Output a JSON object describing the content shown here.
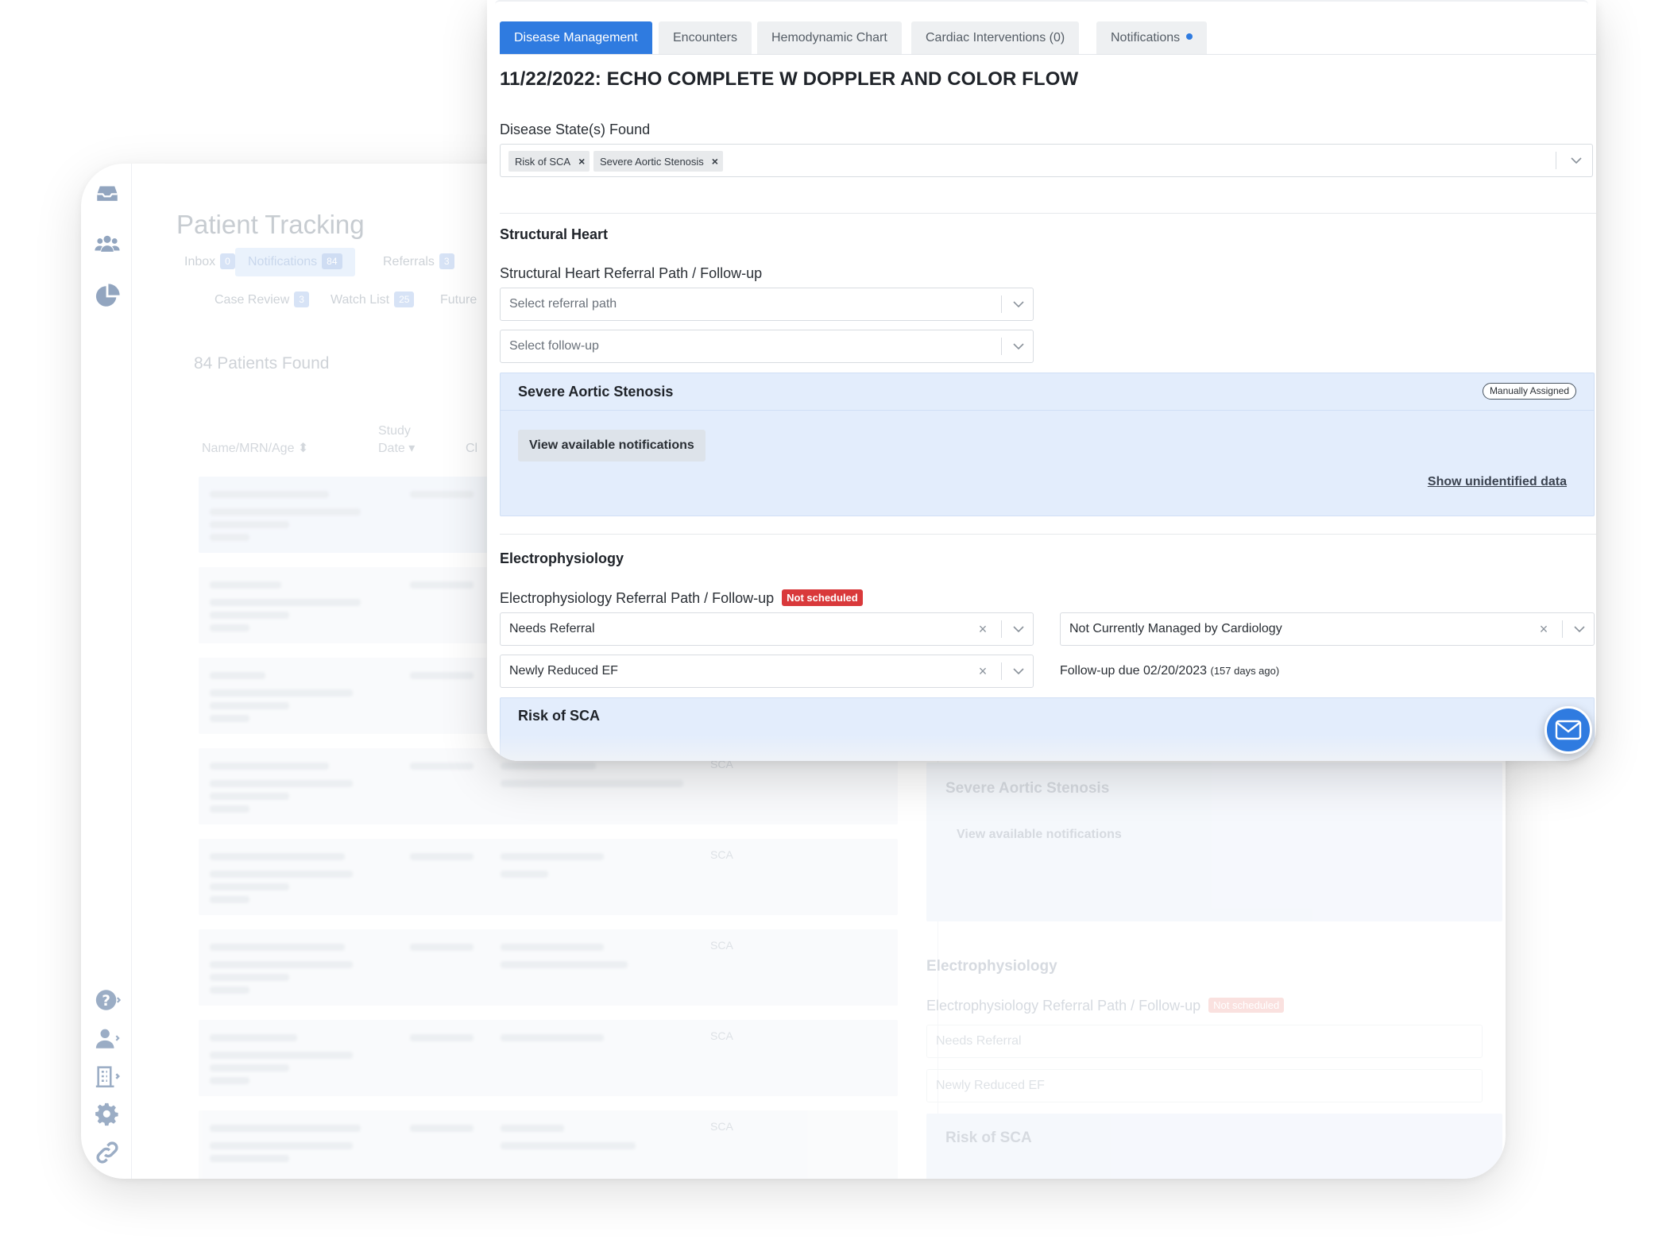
{
  "background": {
    "page_title": "Patient Tracking",
    "tabs_row1": [
      {
        "label": "Inbox",
        "count": "0"
      },
      {
        "label": "Notifications",
        "count": "84"
      },
      {
        "label": "Referrals",
        "count": "3"
      }
    ],
    "tabs_row2": [
      {
        "label": "Case Review",
        "count": "3"
      },
      {
        "label": "Watch List",
        "count": "25"
      },
      {
        "label": "Future"
      }
    ],
    "patients_found": "84 Patients Found",
    "columns": {
      "name": "Name/MRN/Age ⬍",
      "study_line1": "Study",
      "study_line2": "Date ▾",
      "clinical": "Cl"
    },
    "row_tags": [
      "SCA",
      "SCA",
      "SCA",
      "SCA",
      "SCA"
    ],
    "right_panel": {
      "severe_title": "Severe Aortic Stenosis",
      "view_notifications": "View available notifications",
      "ep_heading": "Electrophysiology",
      "ep_label": "Electrophysiology Referral Path / Follow-up",
      "not_scheduled": "Not scheduled",
      "select1": "Needs Referral",
      "select2": "Newly Reduced EF",
      "risk_title": "Risk of SCA"
    },
    "rail_icons": [
      "inbox-icon",
      "patients-icon",
      "pie-chart-icon",
      "help-icon",
      "user-icon",
      "building-icon",
      "settings-icon",
      "link-icon"
    ]
  },
  "foreground": {
    "tabs": [
      {
        "label": "Disease Management",
        "active": true
      },
      {
        "label": "Encounters"
      },
      {
        "label": "Hemodynamic Chart"
      },
      {
        "label": "Cardiac Interventions (0)"
      },
      {
        "label": "Notifications",
        "has_dot": true
      }
    ],
    "study_title": "11/22/2022: ECHO COMPLETE W DOPPLER AND COLOR FLOW",
    "disease_states_label": "Disease State(s) Found",
    "disease_chips": [
      "Risk of SCA",
      "Severe Aortic Stenosis"
    ],
    "structural": {
      "heading": "Structural Heart",
      "path_label": "Structural Heart Referral Path / Follow-up",
      "referral_placeholder": "Select referral path",
      "followup_placeholder": "Select follow-up",
      "panel_title": "Severe Aortic Stenosis",
      "assigned_pill": "Manually Assigned",
      "view_button": "View available notifications",
      "show_link": "Show unidentified data"
    },
    "ep": {
      "heading": "Electrophysiology",
      "path_label": "Electrophysiology Referral Path / Follow-up",
      "status_badge": "Not scheduled",
      "referral_value": "Needs Referral",
      "reason_value": "Newly Reduced EF",
      "managed_value": "Not Currently Managed by Cardiology",
      "followup_text": "Follow-up due 02/20/2023",
      "followup_ago": "(157 days ago)",
      "risk_panel_title": "Risk of SCA"
    },
    "fab_icon": "mail-icon"
  },
  "colors": {
    "accent": "#2f7be0",
    "panel": "#e3edfc",
    "danger": "#d9393b"
  }
}
